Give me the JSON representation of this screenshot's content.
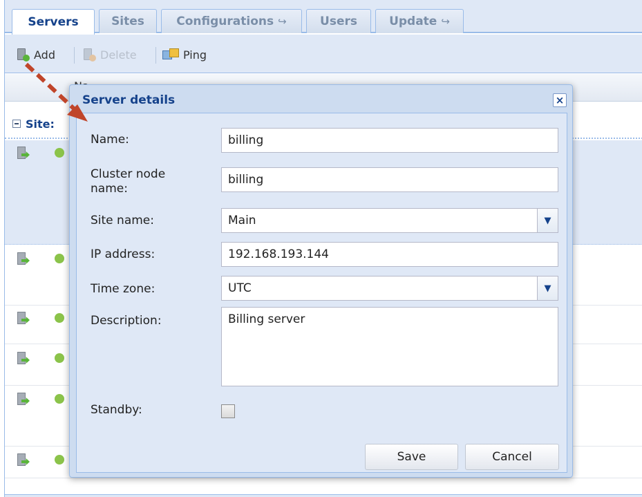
{
  "tabs": [
    {
      "label": "Servers",
      "active": true,
      "arrow": ""
    },
    {
      "label": "Sites",
      "active": false,
      "arrow": ""
    },
    {
      "label": "Configurations",
      "active": false,
      "arrow": "↪"
    },
    {
      "label": "Users",
      "active": false,
      "arrow": ""
    },
    {
      "label": "Update",
      "active": false,
      "arrow": "↪"
    }
  ],
  "toolbar": {
    "add_label": "Add",
    "delete_label": "Delete",
    "ping_label": "Ping"
  },
  "grid": {
    "column_header_partial": "Na",
    "group_label_partial": "Site:"
  },
  "dialog": {
    "title": "Server details",
    "close_glyph": "×",
    "fields": {
      "name": {
        "label": "Name:",
        "value": "billing"
      },
      "cluster_node": {
        "label": "Cluster node name:",
        "value": "billing"
      },
      "site_name": {
        "label": "Site name:",
        "value": "Main"
      },
      "ip_address": {
        "label": "IP address:",
        "value": "192.168.193.144"
      },
      "time_zone": {
        "label": "Time zone:",
        "value": "UTC"
      },
      "description": {
        "label": "Description:",
        "value": "Billing server"
      },
      "standby": {
        "label": "Standby:",
        "checked": false
      }
    },
    "save_label": "Save",
    "cancel_label": "Cancel"
  },
  "colors": {
    "accent": "#15428b",
    "panel_bg": "#dfe8f6",
    "annotation_arrow": "#c0452a"
  }
}
